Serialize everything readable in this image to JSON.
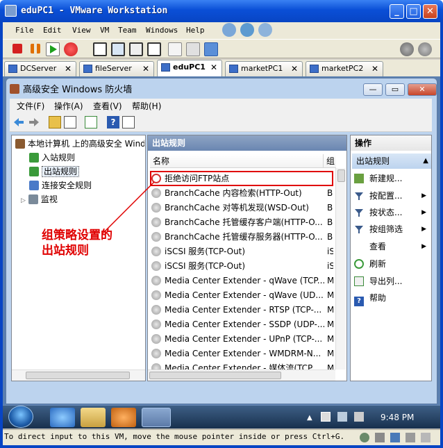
{
  "vm": {
    "title": "eduPC1 - VMware Workstation",
    "menu": [
      "File",
      "Edit",
      "View",
      "VM",
      "Team",
      "Windows",
      "Help"
    ],
    "tabs": [
      {
        "label": "DCServer",
        "active": false
      },
      {
        "label": "fileServer",
        "active": false
      },
      {
        "label": "eduPC1",
        "active": true
      },
      {
        "label": "marketPC1",
        "active": false
      },
      {
        "label": "marketPC2",
        "active": false
      }
    ],
    "status": "To direct input to this VM, move the mouse pointer inside or press Ctrl+G."
  },
  "firewall": {
    "title": "高级安全 Windows 防火墙",
    "menu": [
      "文件(F)",
      "操作(A)",
      "查看(V)",
      "帮助(H)"
    ],
    "tree": {
      "root": "本地计算机 上的高级安全 Windo",
      "items": [
        "入站规则",
        "出站规则",
        "连接安全规则",
        "监视"
      ]
    },
    "middle": {
      "header": "出站规则",
      "col_name": "名称",
      "col_group": "组",
      "rules": [
        {
          "name": "拒绝访问FTP站点",
          "group": "",
          "blocked": true
        },
        {
          "name": "BranchCache 内容检索(HTTP-Out)",
          "group": "Br"
        },
        {
          "name": "BranchCache 对等机发现(WSD-Out)",
          "group": "Br"
        },
        {
          "name": "BranchCache 托管缓存客户端(HTTP-O...",
          "group": "Br"
        },
        {
          "name": "BranchCache 托管缓存服务器(HTTP-O...",
          "group": "Br"
        },
        {
          "name": "iSCSI 服务(TCP-Out)",
          "group": "iS"
        },
        {
          "name": "iSCSI 服务(TCP-Out)",
          "group": "iS"
        },
        {
          "name": "Media Center Extender - qWave (TCP...",
          "group": "M"
        },
        {
          "name": "Media Center Extender - qWave (UD...",
          "group": "M"
        },
        {
          "name": "Media Center Extender - RTSP (TCP-...",
          "group": "M"
        },
        {
          "name": "Media Center Extender - SSDP (UDP-...",
          "group": "M"
        },
        {
          "name": "Media Center Extender - UPnP (TCP-...",
          "group": "M"
        },
        {
          "name": "Media Center Extender - WMDRM-N...",
          "group": "M"
        },
        {
          "name": "Media Center Extender - 媒体流(TCP...",
          "group": "M"
        }
      ]
    },
    "actions": {
      "header": "操作",
      "section": "出站规则",
      "items": [
        "新建规...",
        "按配置...",
        "按状态...",
        "按组筛选",
        "查看",
        "刷新",
        "导出列...",
        "帮助"
      ]
    }
  },
  "annotation": {
    "line1": "组策略设置的",
    "line2": "出站规则"
  },
  "taskbar": {
    "clock": "9:48 PM"
  }
}
